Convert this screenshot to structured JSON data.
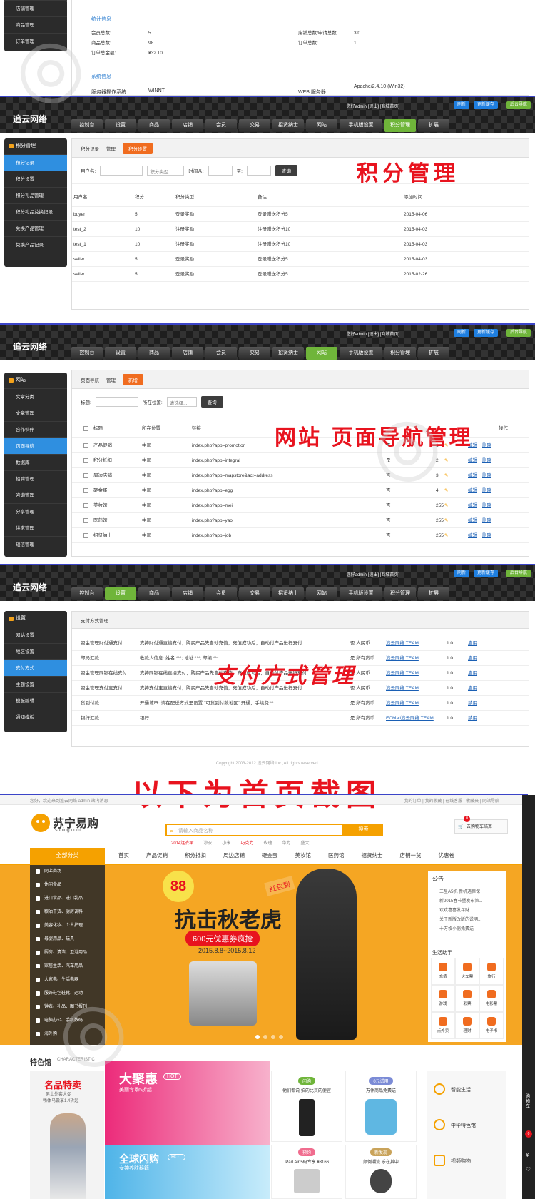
{
  "section0": {
    "side_items": [
      "店铺管理",
      "商品管理",
      "订单管理"
    ],
    "stats_title": "统计信息",
    "stats": [
      [
        "会员总数:",
        "5",
        "店铺总数/申请总数:",
        "3/0"
      ],
      [
        "商品总数:",
        "98",
        "订单总数:",
        "1"
      ],
      [
        "订单总金额:",
        "¥32.10",
        "",
        ""
      ]
    ],
    "sys_title": "系统信息",
    "sys_row": [
      "服务器操作系统:",
      "WINNT",
      "WEB 服务器:",
      "Apache/2.4.10 (Win32)"
    ]
  },
  "topbar": {
    "logo": "追云网络",
    "user": "您好admin [退出] [商城首页]",
    "btn_refresh": "刷新",
    "btn_cache": "更新缓存",
    "btn_nav": "后台导航",
    "nav": [
      "控制台",
      "设置",
      "商品",
      "店铺",
      "会员",
      "交易",
      "招贤纳士",
      "网站",
      "手机版设置",
      "积分管理",
      "扩展"
    ]
  },
  "points": {
    "side_title": "积分管理",
    "side_items": [
      "积分记录",
      "积分设置",
      "积分礼品管理",
      "积分礼品兑换记录",
      "兑换产品管理",
      "兑换产品记录"
    ],
    "crumbs": [
      "积分记录",
      "管理",
      "积分设置"
    ],
    "filter": [
      "用户名:",
      "积分类型",
      "时间从:",
      "至:",
      "查询"
    ],
    "filter_select": "积分类型",
    "headers": [
      "用户名",
      "积分",
      "积分类型",
      "备注",
      "添加时间"
    ],
    "rows": [
      [
        "buyer",
        "5",
        "登录奖励",
        "登录赠送积分5",
        "2015-04-06"
      ],
      [
        "test_2",
        "10",
        "注册奖励",
        "注册赠送积分10",
        "2015-04-03"
      ],
      [
        "test_1",
        "10",
        "注册奖励",
        "注册赠送积分10",
        "2015-04-03"
      ],
      [
        "seller",
        "5",
        "登录奖励",
        "登录赠送积分5",
        "2015-04-03"
      ],
      [
        "seller",
        "5",
        "登录奖励",
        "登录赠送积分5",
        "2015-02-26"
      ]
    ],
    "big_label": "积分管理"
  },
  "nav": {
    "side_title": "网站",
    "side_items": [
      "文章分类",
      "文章管理",
      "合作伙伴",
      "页面导航",
      "数据库",
      "招聘管理",
      "咨询管理",
      "分享管理",
      "供求管理",
      "短信管理"
    ],
    "crumbs": [
      "页面导航",
      "管理",
      "新增"
    ],
    "filter": [
      "标题:",
      "所在位置:",
      "请选择...",
      "查询"
    ],
    "headers": [
      "标题",
      "所在位置",
      "链接",
      "",
      "操作"
    ],
    "rows": [
      [
        "产品促销",
        "中部",
        "index.php?app=promotion",
        "否",
        "1"
      ],
      [
        "积分抵扣",
        "中部",
        "index.php?app=integral",
        "是",
        "2"
      ],
      [
        "周边店铺",
        "中部",
        "index.php?app=mapstore&act=address",
        "否",
        "3"
      ],
      [
        "砸金蛋",
        "中部",
        "index.php?app=egg",
        "否",
        "4"
      ],
      [
        "美妆馆",
        "中部",
        "index.php?app=mei",
        "否",
        "255"
      ],
      [
        "医药馆",
        "中部",
        "index.php?app=yao",
        "否",
        "255"
      ],
      [
        "招贤纳士",
        "中部",
        "index.php?app=job",
        "否",
        "255"
      ]
    ],
    "op_edit": "编辑",
    "op_del": "删除",
    "big_label": "网站 页面导航管理"
  },
  "pay": {
    "side_title": "设置",
    "side_items": [
      "网站设置",
      "地区设置",
      "支付方式",
      "主题设置",
      "模板编辑",
      "通知模板"
    ],
    "crumb": "支付方式管理",
    "rows": [
      [
        "资金管理财付通支付",
        "支持财付通直接支付，购买产品先自动充值，充值成功后，自动付产品进行支付",
        "否 人民币",
        "追云网络 TEAM",
        "1.0",
        "启用"
      ],
      [
        "邮局汇款",
        "收款人信息: 姓名 ***; 地址:***; 邮编 ***",
        "是 所有货币",
        "追云网络 TEAM",
        "1.0",
        "启用"
      ],
      [
        "资金管理网银在线支付",
        "支持网银在线直接支付，购买产品先自动充值，充值成功后，自动付产品进行支付",
        "否 人民币",
        "追云网络 TEAM",
        "1.0",
        "启用"
      ],
      [
        "资金管理支付宝支付",
        "支持支付宝直接支付，购买产品先自动充值，充值成功后，自动付产品进行支付",
        "否 人民币",
        "追云网络 TEAM",
        "1.0",
        "启用"
      ],
      [
        "货到付款",
        "开通城市: 请在配送方式里设置 \"可货到付款地区\" 开通，手续费:**",
        "是 所有货币",
        "追云网络 TEAM",
        "1.0",
        "禁用"
      ],
      [
        "银行汇款",
        "银行",
        "是 所有货币",
        "ECMall追云网络 TEAM",
        "1.0",
        "禁用"
      ]
    ],
    "copyright": "Copyright 2003-2012 追云网络 Inc.,All rights reserved.",
    "big_label": "支付方式管理"
  },
  "divider": "以下为首页截图",
  "home": {
    "topline": "您好，欢迎来到追云网络   admin   站内消息",
    "topright": "我的订单 | 我的收藏 | 在线客服 | 收藏夹 | 网站导航",
    "logo_cn": "苏宁易购",
    "logo_en": "suning.com",
    "search_placeholder": "请输入商品名称",
    "search_btn": "搜索",
    "hot": [
      "2014连衣裙",
      "凉衣",
      "小米",
      "巧克力",
      "玫瑰",
      "华为",
      "盛大"
    ],
    "cart": "去购物车结算",
    "cart_count": "0",
    "all_cat": "全部分类",
    "nav": [
      "首页",
      "产品促销",
      "积分抵扣",
      "周边店铺",
      "砸金蛋",
      "美妆馆",
      "医药馆",
      "招贤纳士",
      "店铺一览",
      "优惠卷"
    ],
    "cats": [
      "网上商场",
      "休闲食品",
      "进口食品、进口乳品",
      "粮油干货、厨房调料",
      "美容化妆、个人护理",
      "母婴用品、玩具",
      "厨房、清洁、卫浴用品",
      "家居生活、汽车用品",
      "大家电、生活电器",
      "服饰鞋包鞋靴、运动",
      "钟表、礼品、图书报刊",
      "电脑办公、手机数码",
      "海外购"
    ],
    "banner_badge": "88",
    "banner_title": "抗击秋老虎",
    "banner_coupon": "600元优惠券疯抢",
    "banner_date": "2015.8.8~2015.8.12",
    "banner_tag": "红包到",
    "notice_title": "公告",
    "notices": [
      "三星A5机 新机遇担保",
      "新2015春节暨发布第...",
      "欢欢喜喜发年财",
      "关于新版改版的说明...",
      "十万枚小俏免费送"
    ],
    "helper_title": "生活助手",
    "helpers": [
      "充值",
      "火车票",
      "旅行",
      "游戏",
      "彩票",
      "电影票",
      "点外卖",
      "理财",
      "电子书"
    ],
    "feature_title": "特色馆",
    "feature_en": "CHARACTERISTIC",
    "feat1": "名品特卖",
    "feat1_sub": "男士外套大促",
    "feat1_sub2": "畅体乌囊享1.4折起",
    "feat2": "大聚惠",
    "feat2_tag": "HOT",
    "feat2_sub": "美丽专场5折起",
    "feat3": "全球闪购",
    "feat3_tag": "HOT",
    "feat3_sub": "女神养肤秘籍",
    "card1_tag": "闪购",
    "card1": "他们都说 拍的比买的便宜",
    "card2_tag": "0元试用",
    "card2": "万件商品免费送",
    "card3_tag": "预约",
    "card3": "iPad Air 5码专享 ¥3166",
    "card4_tag": "新发现",
    "card4": "颠倒潮流 乐在其中",
    "right_links": [
      "智能生活",
      "中华特色馆",
      "视频购物"
    ],
    "sidebar": [
      "购物车",
      "0"
    ]
  }
}
